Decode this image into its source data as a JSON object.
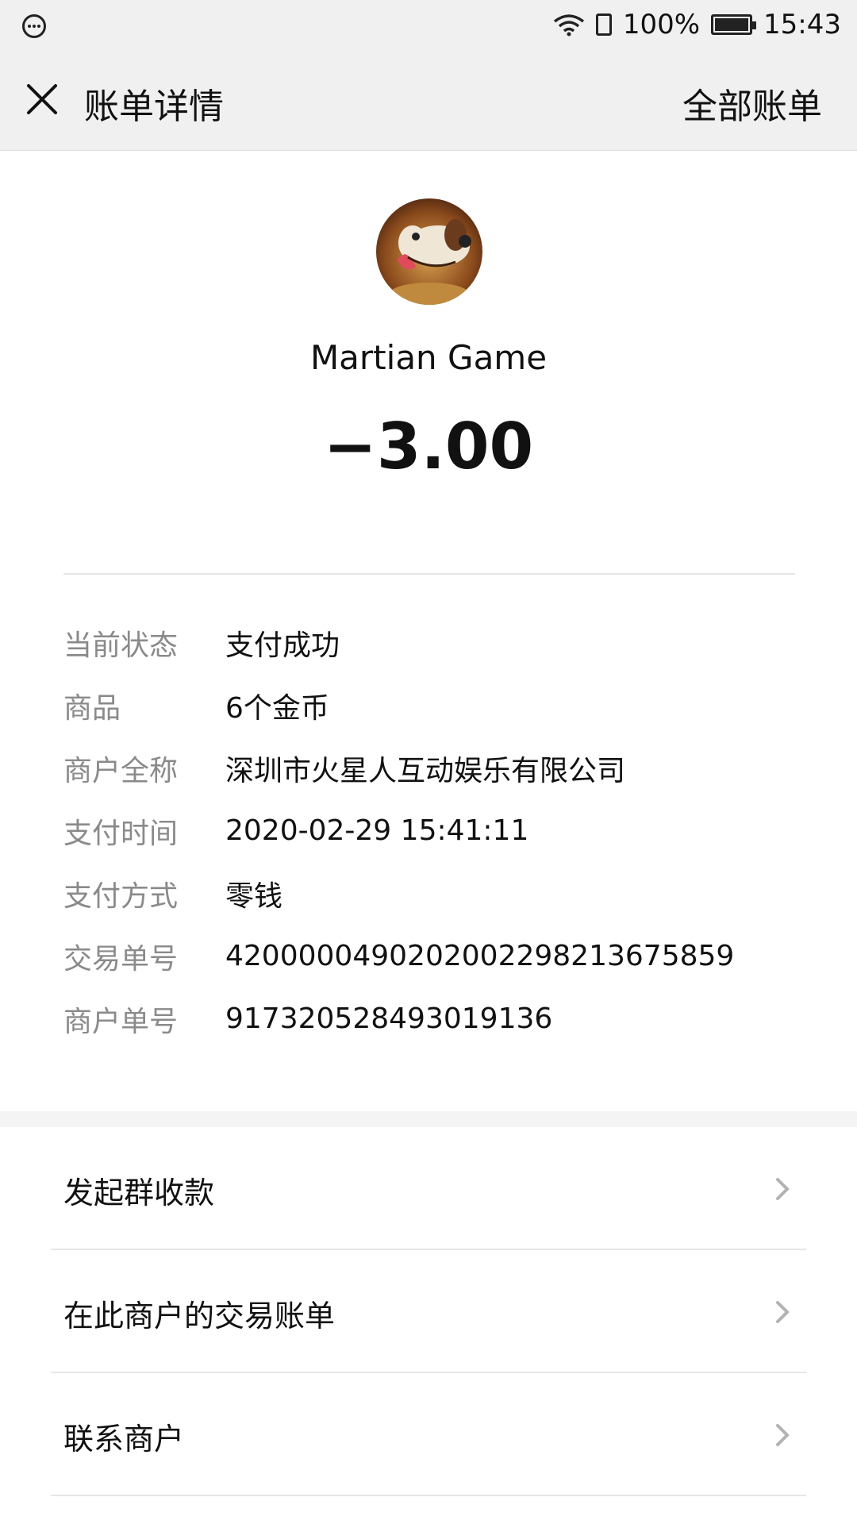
{
  "status_bar": {
    "battery": "100%",
    "time": "15:43",
    "icons": [
      "message-icon",
      "wifi-icon",
      "sim-icon",
      "battery-icon"
    ]
  },
  "nav": {
    "close_icon": "close-icon",
    "title": "账单详情",
    "all_bills": "全部账单"
  },
  "header": {
    "avatar": "merchant-avatar",
    "merchant_name": "Martian Game",
    "amount": "−3.00"
  },
  "details": [
    {
      "label": "当前状态",
      "value": "支付成功"
    },
    {
      "label": "商品",
      "value": "6个金币"
    },
    {
      "label": "商户全称",
      "value": "深圳市火星人互动娱乐有限公司"
    },
    {
      "label": "支付时间",
      "value": "2020-02-29 15:41:11"
    },
    {
      "label": "支付方式",
      "value": "零钱"
    },
    {
      "label": "交易单号",
      "value": "4200000490202002298213675859"
    },
    {
      "label": "商户单号",
      "value": "917320528493019136"
    }
  ],
  "actions": [
    {
      "label": "发起群收款"
    },
    {
      "label": "在此商户的交易账单"
    },
    {
      "label": "联系商户"
    }
  ],
  "colors": {
    "bar_background": "#f0f0f0",
    "label_gray": "#8a8a8a",
    "divider": "#e6e6e6"
  }
}
